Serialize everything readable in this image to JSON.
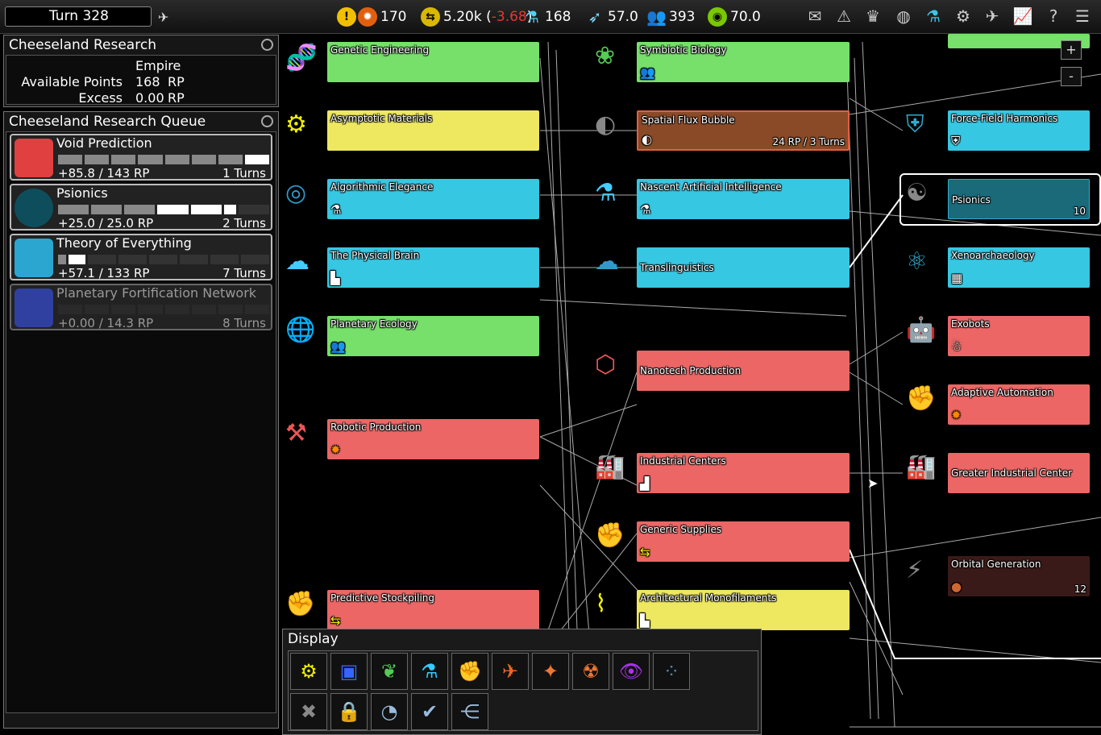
{
  "topbar": {
    "turn": "Turn 328",
    "industry": "170",
    "influence_total": "5.20k",
    "influence_open": " (",
    "influence_change": "-3.68",
    "influence_close": ")",
    "research": "168",
    "trade": "57.0",
    "population": "393",
    "stability": "70.0"
  },
  "research_panel": {
    "title": "Cheeseland Research",
    "col_header": "Empire",
    "available_label": "Available Points",
    "available_value": "168",
    "available_unit": "RP",
    "excess_label": "Excess",
    "excess_value": "0.00",
    "excess_unit": "RP"
  },
  "queue": {
    "title": "Cheeseland Research Queue",
    "items": [
      {
        "name": "Void Prediction",
        "rp": "+85.8 / 143 RP",
        "turns": "1 Turns",
        "progress": 0.95
      },
      {
        "name": "Psionics",
        "rp": "+25.0 / 25.0 RP",
        "turns": "2 Turns",
        "progress": 0.7
      },
      {
        "name": "Theory of Everything",
        "rp": "+57.1 / 133 RP",
        "turns": "7 Turns",
        "progress": 0.1
      },
      {
        "name": "Planetary Fortification Network",
        "rp": "+0.00 / 14.3 RP",
        "turns": "8 Turns",
        "progress": 0.0
      }
    ]
  },
  "tree": {
    "col1": [
      {
        "name": "Genetic Engineering",
        "color": "green"
      },
      {
        "name": "Asymptotic Materials",
        "color": "yellow"
      },
      {
        "name": "Algorithmic Elegance",
        "color": "blue"
      },
      {
        "name": "The Physical Brain",
        "color": "blue"
      },
      {
        "name": "Planetary Ecology",
        "color": "green"
      },
      {
        "name": "Robotic Production",
        "color": "red"
      },
      {
        "name": "Predictive Stockpiling",
        "color": "red"
      }
    ],
    "col2": [
      {
        "name": "Symbiotic Biology",
        "color": "green"
      },
      {
        "name": "Spatial Flux Bubble",
        "color": "orange",
        "cost": "24 RP / 3 Turns"
      },
      {
        "name": "Nascent Artificial Intelligence",
        "color": "blue"
      },
      {
        "name": "Translinguistics",
        "color": "blue"
      },
      {
        "name": "Nanotech Production",
        "color": "red"
      },
      {
        "name": "Industrial Centers",
        "color": "red"
      },
      {
        "name": "Generic Supplies",
        "color": "red"
      },
      {
        "name": "Architectural Monofilaments",
        "color": "yellow"
      }
    ],
    "col3": [
      {
        "name": "Force-Field Harmonics",
        "color": "blue"
      },
      {
        "name": "Psionics",
        "color": "teal",
        "cost": "10"
      },
      {
        "name": "Xenoarchaeology",
        "color": "blue"
      },
      {
        "name": "Exobots",
        "color": "red"
      },
      {
        "name": "Adaptive Automation",
        "color": "red"
      },
      {
        "name": "Greater Industrial Center",
        "color": "red"
      },
      {
        "name": "Orbital Generation",
        "color": "darkred",
        "cost": "12"
      }
    ],
    "zoom_in": "+",
    "zoom_out": "-"
  },
  "display_panel": {
    "title": "Display",
    "buttons": [
      "gear-category-icon",
      "growth-category-icon",
      "leaf-category-icon",
      "flask-category-icon",
      "production-category-icon",
      "ship-category-icon",
      "defense-category-icon",
      "hazard-category-icon",
      "eye-category-icon",
      "dots-category-icon",
      "unavailable-filter-icon",
      "locked-filter-icon",
      "partial-filter-icon",
      "complete-filter-icon",
      "tree-view-icon"
    ]
  }
}
